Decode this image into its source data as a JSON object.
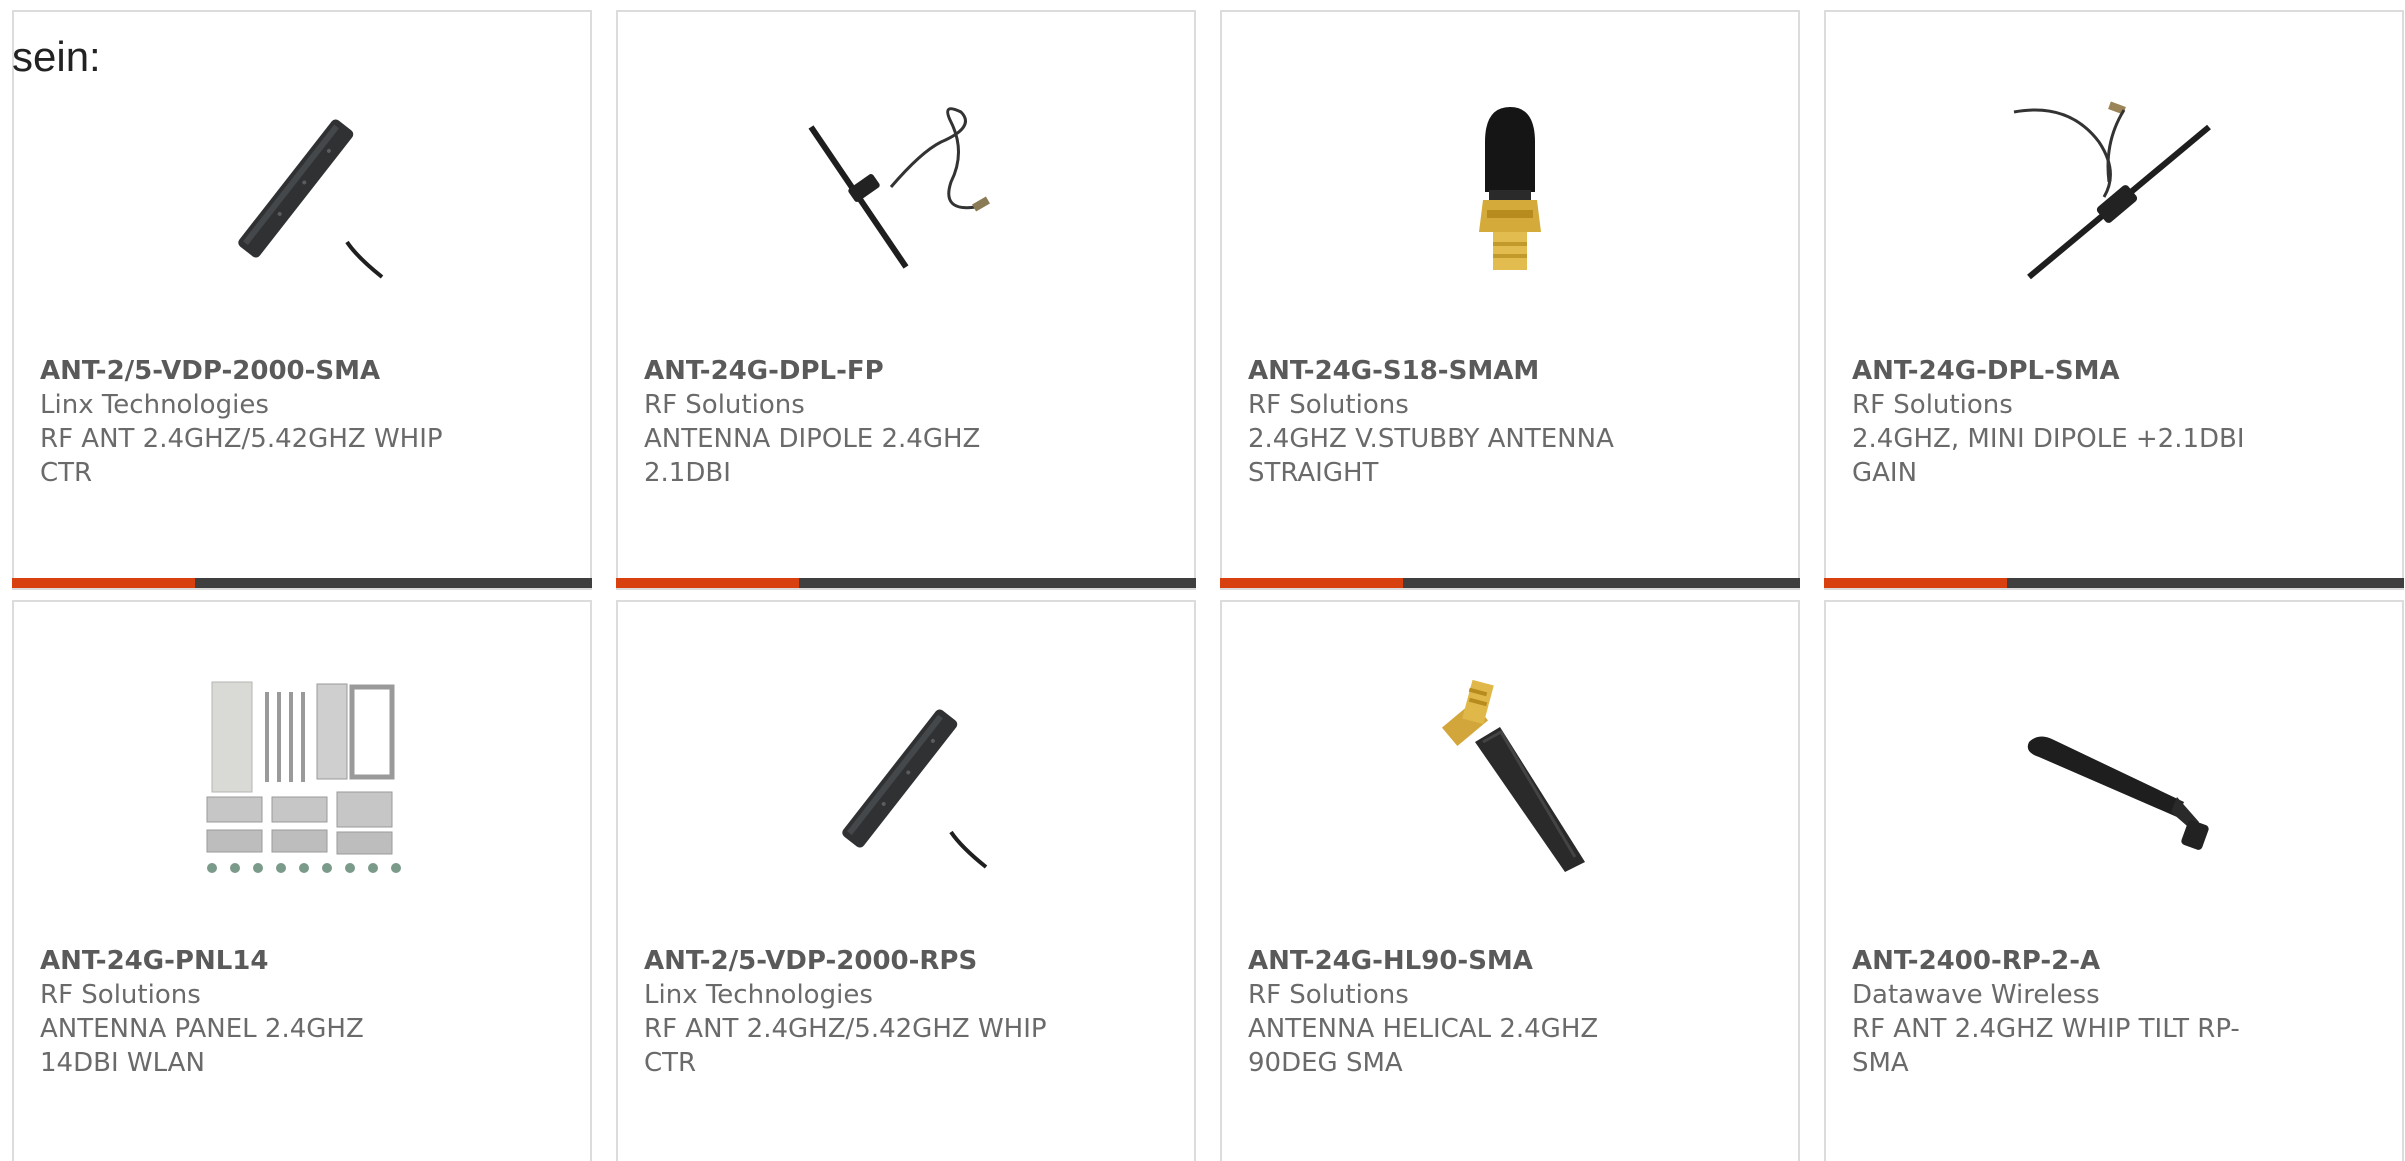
{
  "intro_text": "sein:",
  "products": [
    {
      "part_number": "ANT-2/5-VDP-2000-SMA",
      "manufacturer": "Linx Technologies",
      "description": "RF ANT 2.4GHZ/5.42GHZ WHIP CTR",
      "image": "flat-black-vertical-dipole-antenna"
    },
    {
      "part_number": "ANT-24G-DPL-FP",
      "manufacturer": "RF Solutions",
      "description": "ANTENNA DIPOLE 2.4GHZ 2.1DBI",
      "image": "dipole-antenna-with-cable"
    },
    {
      "part_number": "ANT-24G-S18-SMAM",
      "manufacturer": "RF Solutions",
      "description": "2.4GHZ V.STUBBY ANTENNA STRAIGHT",
      "image": "stubby-antenna-brass-sma"
    },
    {
      "part_number": "ANT-24G-DPL-SMA",
      "manufacturer": "RF Solutions",
      "description": "2.4GHZ, MINI DIPOLE +2.1DBI GAIN",
      "image": "mini-dipole-antenna-with-cable"
    },
    {
      "part_number": "ANT-24G-PNL14",
      "manufacturer": "RF Solutions",
      "description": "ANTENNA PANEL 2.4GHZ 14DBI WLAN",
      "image": "panel-antenna-with-mounting-kit"
    },
    {
      "part_number": "ANT-2/5-VDP-2000-RPS",
      "manufacturer": "Linx Technologies",
      "description": "RF ANT 2.4GHZ/5.42GHZ WHIP CTR",
      "image": "flat-black-vertical-dipole-antenna"
    },
    {
      "part_number": "ANT-24G-HL90-SMA",
      "manufacturer": "RF Solutions",
      "description": "ANTENNA HELICAL 2.4GHZ 90DEG SMA",
      "image": "helical-antenna-90-degree"
    },
    {
      "part_number": "ANT-2400-RP-2-A",
      "manufacturer": "Datawave Wireless",
      "description": "RF ANT 2.4GHZ WHIP TILT RP-SMA",
      "image": "whip-tilt-antenna"
    }
  ],
  "colors": {
    "accent": "#d9400f",
    "bar": "#3f3f3f",
    "border": "#dcdcdc",
    "text": "#6a6a6a"
  }
}
